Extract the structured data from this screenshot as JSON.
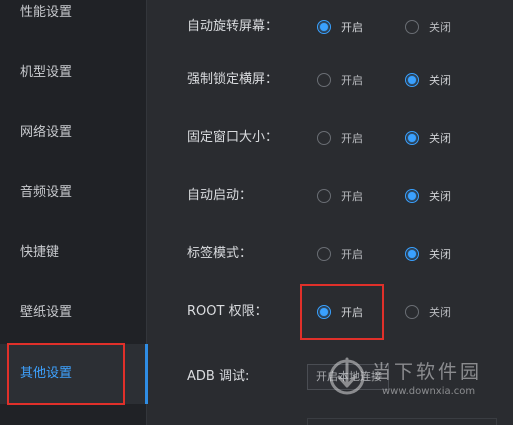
{
  "sidebar": {
    "items": [
      {
        "label": "性能设置"
      },
      {
        "label": "机型设置"
      },
      {
        "label": "网络设置"
      },
      {
        "label": "音频设置"
      },
      {
        "label": "快捷键"
      },
      {
        "label": "壁纸设置"
      },
      {
        "label": "其他设置"
      }
    ],
    "active_index": 6
  },
  "settings": {
    "rows": [
      {
        "label": "自动旋转屏幕：",
        "on_label": "开启",
        "off_label": "关闭",
        "selected": "on"
      },
      {
        "label": "强制锁定横屏：",
        "on_label": "开启",
        "off_label": "关闭",
        "selected": "off"
      },
      {
        "label": "固定窗口大小：",
        "on_label": "开启",
        "off_label": "关闭",
        "selected": "off"
      },
      {
        "label": "自动启动：",
        "on_label": "开启",
        "off_label": "关闭",
        "selected": "off"
      },
      {
        "label": "标签模式：",
        "on_label": "开启",
        "off_label": "关闭",
        "selected": "off"
      },
      {
        "label": "ROOT 权限：",
        "on_label": "开启",
        "off_label": "关闭",
        "selected": "on"
      }
    ],
    "adb": {
      "label": "ADB 调试:",
      "value": "开启本地连接"
    }
  },
  "watermark": {
    "text": "当下软件园",
    "url": "www.downxia.com"
  },
  "colors": {
    "accent": "#3aa1ff",
    "highlight_box": "#e0302a",
    "sidebar_bg": "#202226",
    "panel_bg": "#2a2c30"
  }
}
